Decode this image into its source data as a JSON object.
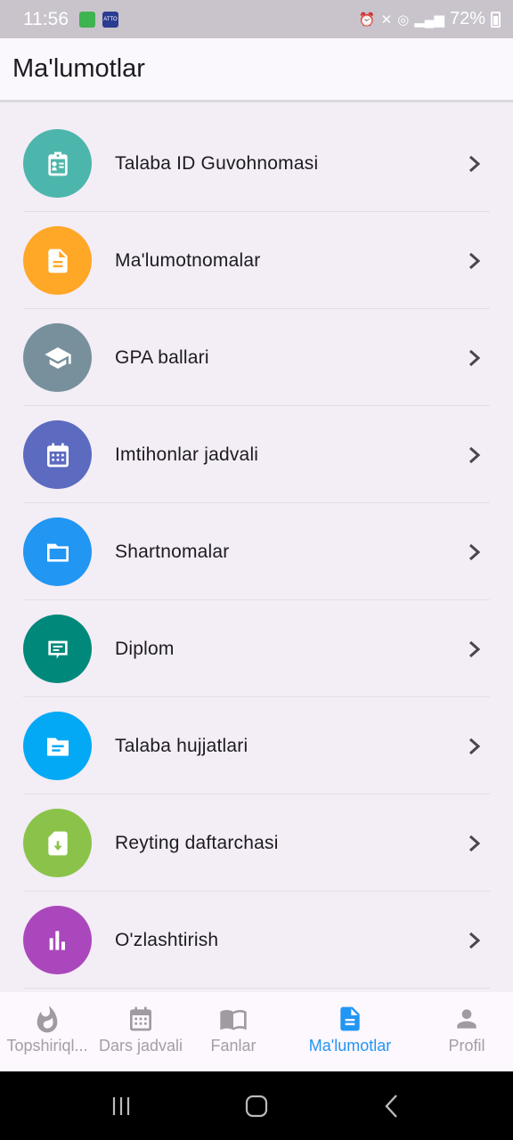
{
  "status_bar": {
    "time": "11:56",
    "app1_label": "",
    "app2_label": "ATTO",
    "battery": "72%"
  },
  "app_bar": {
    "title": "Ma'lumotlar"
  },
  "menu": {
    "items": [
      {
        "label": "Talaba ID Guvohnomasi",
        "icon": "id-badge-icon",
        "color": "#4db6ac"
      },
      {
        "label": "Ma'lumotnomalar",
        "icon": "document-icon",
        "color": "#ffa726"
      },
      {
        "label": "GPA ballari",
        "icon": "graduation-cap-icon",
        "color": "#78909c"
      },
      {
        "label": "Imtihonlar jadvali",
        "icon": "calendar-icon",
        "color": "#5c6bc0"
      },
      {
        "label": "Shartnomalar",
        "icon": "folder-icon",
        "color": "#2196f3"
      },
      {
        "label": "Diplom",
        "icon": "diploma-icon",
        "color": "#00897b"
      },
      {
        "label": "Talaba hujjatlari",
        "icon": "student-documents-icon",
        "color": "#03a9f4"
      },
      {
        "label": "Reyting daftarchasi",
        "icon": "grade-book-icon",
        "color": "#8bc34a"
      },
      {
        "label": "O'zlashtirish",
        "icon": "bar-chart-icon",
        "color": "#ab47bc"
      }
    ]
  },
  "bottom_nav": {
    "items": [
      {
        "label": "Topshiriql...",
        "icon": "flame-icon"
      },
      {
        "label": "Dars jadvali",
        "icon": "calendar-icon"
      },
      {
        "label": "Fanlar",
        "icon": "book-icon"
      },
      {
        "label": "Ma'lumotlar",
        "icon": "document-icon",
        "active": true
      },
      {
        "label": "Profil",
        "icon": "person-icon"
      }
    ]
  }
}
